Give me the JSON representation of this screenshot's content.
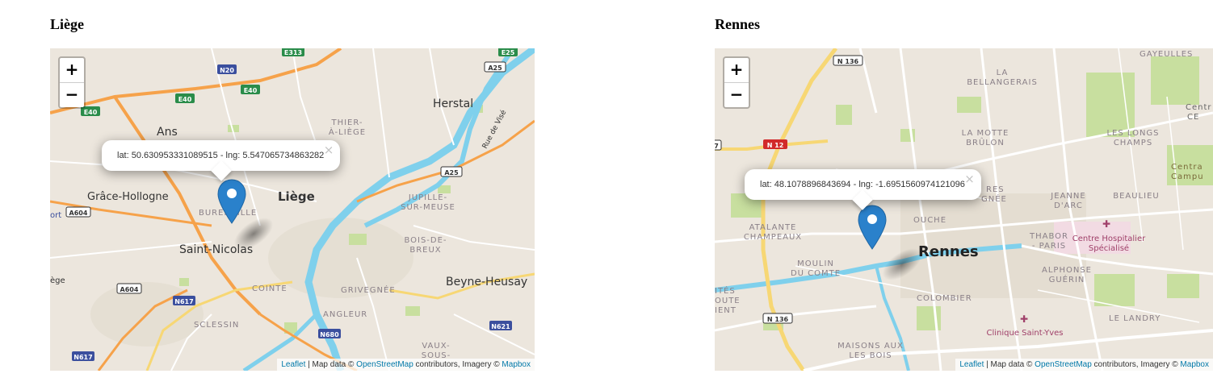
{
  "maps": [
    {
      "title": "Liège",
      "zoom_in": "+",
      "zoom_out": "−",
      "popup_text": "lat: 50.630953331089515 - lng: 5.547065734863282",
      "popup_close": "×",
      "labels": {
        "ans": "Ans",
        "herstal": "Herstal",
        "thier1": "THIER-",
        "thier2": "À-LIÈGE",
        "grace": "Grâce-Hollogne",
        "liege": "Liège",
        "jupille1": "JUPILLE-",
        "jupille2": "SUR-MEUSE",
        "bureni": "BURENVILLE",
        "saint_nicolas": "Saint-Nicolas",
        "bois1": "BOIS-DE-",
        "bois2": "BREUX",
        "coin": "COINTE",
        "grivegnee": "GRIVEGNÉE",
        "beyne": "Beyne-Heusay",
        "angleur": "ANGLEUR",
        "sclessin": "SCLESSIN",
        "vaux1": "VAUX-",
        "vaux2": "SOUS-",
        "rue_vise": "Rue de Visé",
        "ort": "ort",
        "ege": "ège"
      },
      "road_shields": {
        "e313": "E313",
        "e25": "E25",
        "n20": "N20",
        "a25a": "A25",
        "e40a": "E40",
        "e40b": "E40",
        "e40c": "E40",
        "a25b": "A25",
        "a604a": "A604",
        "a604b": "A604",
        "n617a": "N617",
        "n680": "N680",
        "n621": "N621",
        "n617b": "N617"
      },
      "attribution": {
        "leaflet": "Leaflet",
        "sep": " | Map data © ",
        "osm": "OpenStreetMap",
        "mid": " contributors, Imagery © ",
        "mapbox": "Mapbox"
      }
    },
    {
      "title": "Rennes",
      "zoom_in": "+",
      "zoom_out": "−",
      "popup_text": "lat: 48.1078896843694 - lng: -1.6951560974121096",
      "popup_close": "×",
      "labels": {
        "gayeulles": "GAYEULLES",
        "bell1": "LA",
        "bell2": "BELLANGERAIS",
        "motte1": "LA MOTTE",
        "motte2": "BRÛLON",
        "longs1": "LES LONGS",
        "longs2": "CHAMPS",
        "centr1": "Centr",
        "centr2": "CE",
        "campus1": "Centra",
        "campus2": "Campu",
        "res": "RES",
        "gne": "GNÉE",
        "jeanne1": "JEANNE",
        "jeanne2": "D'ARC",
        "beaulieu": "BEAULIEU",
        "atalante1": "ATALANTE",
        "atalante2": "CHAMPEAUX",
        "ouche": "OUCHE",
        "thabor1": "THABOR",
        "thabor2": "- PARIS",
        "chu1": "Centre Hospitalier",
        "chu2": "Spécialisé",
        "moulin1": "MOULIN",
        "moulin2": "DU COMTE",
        "rennes": "Rennes",
        "alphonse1": "ALPHONSE",
        "alphonse2": "GUÉRIN",
        "ites1": "ITÉS",
        "ites2": "OUTE",
        "ites3": "IENT",
        "colombier": "COLOMBIER",
        "landry": "LE LANDRY",
        "clinique": "Clinique Saint-Yves",
        "maisons1": "MAISONS AUX",
        "maisons2": "LES BOIS"
      },
      "road_shields": {
        "n136a": "N 136",
        "n12": "N 12",
        "n136b": "N 136",
        "n7": "7"
      },
      "attribution": {
        "leaflet": "Leaflet",
        "sep": " | Map data © ",
        "osm": "OpenStreetMap",
        "mid": " contributors, Imagery © ",
        "mapbox": "Mapbox"
      }
    }
  ],
  "colors": {
    "map_bg": "#ece6dd",
    "water": "#7fd0ec",
    "park": "#c8df9f",
    "motorway": "#f6a24a",
    "trunk": "#f7d774",
    "marker": "#2a81cb",
    "link": "#0078a8"
  }
}
